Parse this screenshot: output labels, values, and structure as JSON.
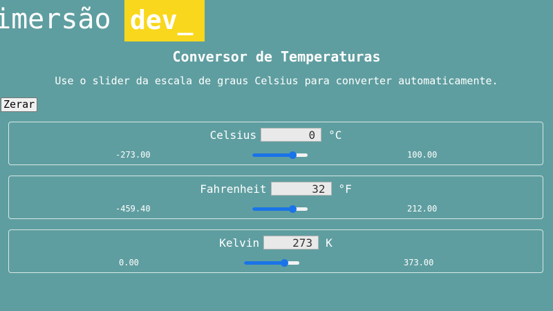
{
  "logo": {
    "light_text": "imersão",
    "bold_text": "dev_",
    "box_color": "#f9d71c"
  },
  "header": {
    "title": "Conversor de Temperaturas",
    "subtitle": "Use o slider da escala de graus Celsius para converter automaticamente."
  },
  "reset_label": "Zerar",
  "colors": {
    "background": "#5f9ea0",
    "slider_accent": "#1a73e8"
  },
  "scales": [
    {
      "id": "celsius",
      "label": "Celsius",
      "value": "0",
      "symbol": "°C",
      "min": "-273.00",
      "max": "100.00",
      "slider_fraction": 0.73
    },
    {
      "id": "fahrenheit",
      "label": "Fahrenheit",
      "value": "32",
      "symbol": "°F",
      "min": "-459.40",
      "max": "212.00",
      "slider_fraction": 0.73
    },
    {
      "id": "kelvin",
      "label": "Kelvin",
      "value": "273",
      "symbol": "K",
      "min": "0.00",
      "max": "373.00",
      "slider_fraction": 0.73
    }
  ]
}
